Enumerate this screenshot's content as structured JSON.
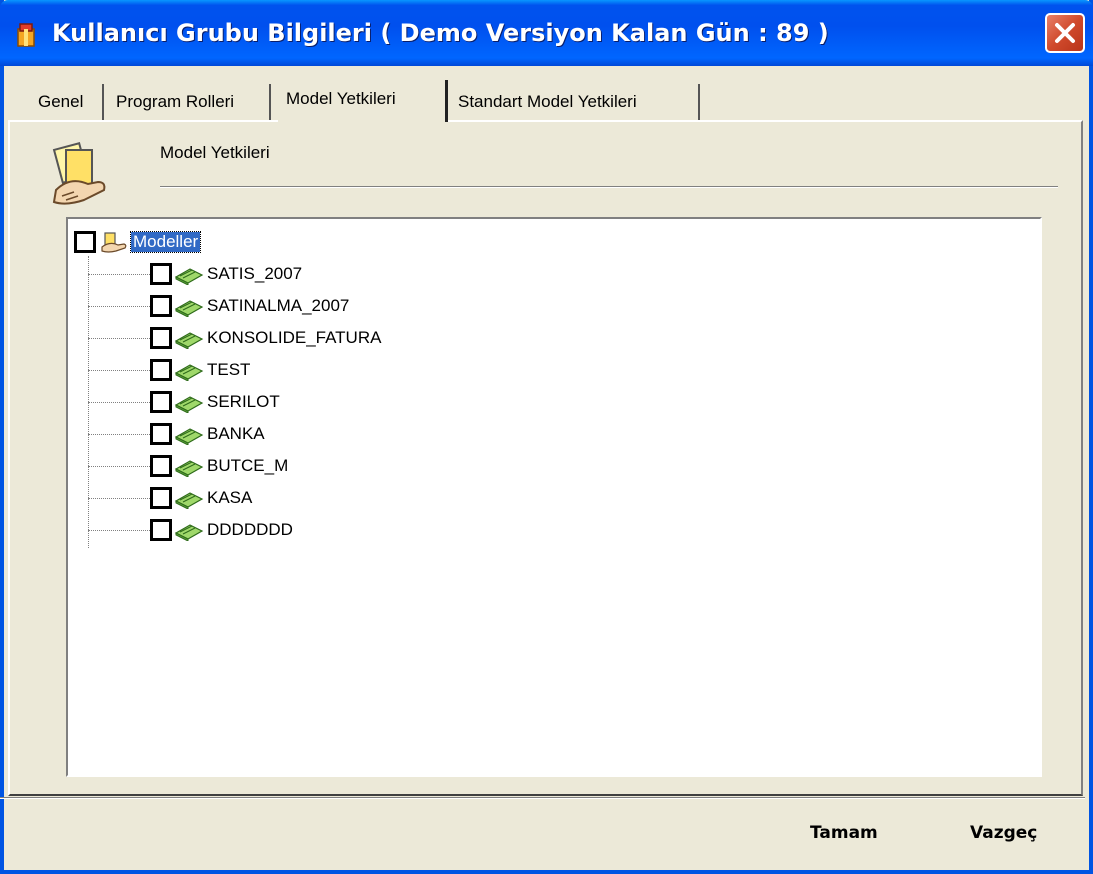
{
  "window": {
    "title": "Kullanıcı Grubu Bilgileri ( Demo Versiyon  Kalan Gün : 89 )"
  },
  "tabs": [
    {
      "label": "Genel"
    },
    {
      "label": "Program Rolleri"
    },
    {
      "label": "Model Yetkileri"
    },
    {
      "label": "Standart Model Yetkileri"
    }
  ],
  "section": {
    "title": "Model Yetkileri"
  },
  "tree": {
    "root": {
      "label": "Modeller",
      "checked": false
    },
    "children": [
      {
        "label": "SATIS_2007",
        "checked": false
      },
      {
        "label": "SATINALMA_2007",
        "checked": false
      },
      {
        "label": "KONSOLIDE_FATURA",
        "checked": false
      },
      {
        "label": "TEST",
        "checked": false
      },
      {
        "label": "SERILOT",
        "checked": false
      },
      {
        "label": "BANKA",
        "checked": false
      },
      {
        "label": "BUTCE_M",
        "checked": false
      },
      {
        "label": "KASA",
        "checked": false
      },
      {
        "label": "DDDDDDD",
        "checked": false
      }
    ]
  },
  "buttons": {
    "ok": "Tamam",
    "cancel": "Vazgeç"
  },
  "colors": {
    "titlebar": "#0054e3",
    "window_bg": "#ece9d8",
    "selection": "#316ac5",
    "close_button": "#d04a2c"
  }
}
